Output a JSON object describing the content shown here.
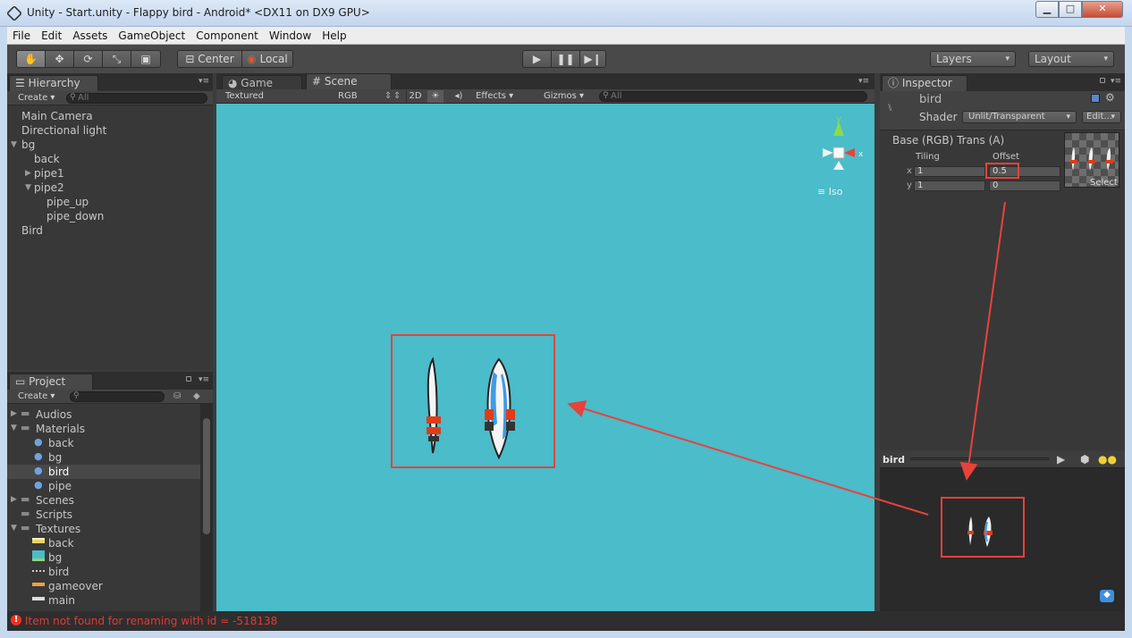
{
  "window": {
    "title": "Unity - Start.unity - Flappy bird - Android* <DX11 on DX9 GPU>",
    "min_glyph": "▁",
    "max_glyph": "□",
    "close_glyph": "✕"
  },
  "menu": [
    "File",
    "Edit",
    "Assets",
    "GameObject",
    "Component",
    "Window",
    "Help"
  ],
  "toolbar": {
    "pivot_label": "Center",
    "space_label": "Local",
    "layers_label": "Layers",
    "layout_label": "Layout"
  },
  "hierarchy": {
    "tab_label": "Hierarchy",
    "create_label": "Create ▾",
    "search_placeholder": "All",
    "items": [
      "Main Camera",
      "Directional light",
      "bg",
      "back",
      "pipe1",
      "pipe2",
      "pipe_up",
      "pipe_down",
      "Bird"
    ]
  },
  "project": {
    "tab_label": "Project",
    "create_label": "Create ▾",
    "items": [
      "Audios",
      "Materials",
      "back",
      "bg",
      "bird",
      "pipe",
      "Scenes",
      "Scripts",
      "Textures",
      "back",
      "bg",
      "bird",
      "gameover",
      "main"
    ]
  },
  "scene_tabs": {
    "game_label": "Game",
    "scene_label": "Scene",
    "render_mode": "Textured",
    "color_mode": "RGB",
    "mode_2d": "2D",
    "effects_label": "Effects",
    "gizmos_label": "Gizmos",
    "search_placeholder": "All",
    "gizmo_y": "y",
    "gizmo_x": "x",
    "iso_label": "Iso"
  },
  "inspector": {
    "tab_label": "Inspector",
    "material_name": "bird",
    "shader_label": "Shader",
    "shader_value": "Unlit/Transparent",
    "edit_label": "Edit...",
    "texture_label": "Base (RGB) Trans (A)",
    "tiling_label": "Tiling",
    "offset_label": "Offset",
    "x_label": "x",
    "y_label": "y",
    "tiling_x": "1",
    "tiling_y": "1",
    "offset_x": "0.5",
    "offset_y": "0",
    "select_label": "Select"
  },
  "preview": {
    "title": "bird"
  },
  "status": {
    "error_text": "Item not found for renaming with id = -518138"
  },
  "colors": {
    "scene_bg": "#4abcca",
    "annotation_red": "#e8423b",
    "error_red": "#e23b36"
  }
}
